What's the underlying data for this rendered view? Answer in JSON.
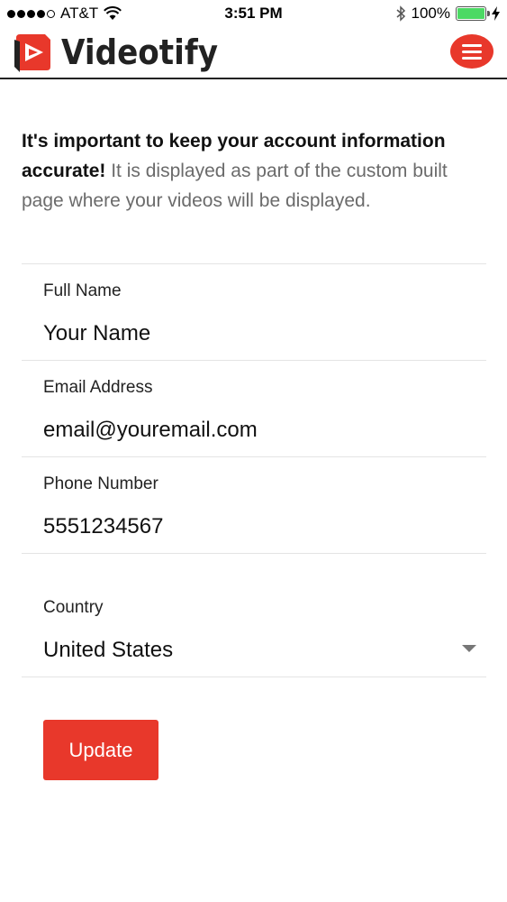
{
  "status_bar": {
    "carrier": "AT&T",
    "time": "3:51 PM",
    "battery": "100%",
    "battery_level": 1.0
  },
  "header": {
    "brand": "Videotify",
    "logo_icon": "videotify-play-logo",
    "menu_icon": "hamburger-menu-icon",
    "accent_color": "#e8382b"
  },
  "intro": {
    "bold_text": "It's important to keep your account information accurate!",
    "text": " It is displayed as part of the custom built page where your videos will be displayed."
  },
  "form": {
    "full_name": {
      "label": "Full Name",
      "value": "Your Name"
    },
    "email": {
      "label": "Email Address",
      "value": "email@youremail.com"
    },
    "phone": {
      "label": "Phone Number",
      "value": "5551234567"
    },
    "country": {
      "label": "Country",
      "value": "United States"
    },
    "submit_label": "Update"
  }
}
